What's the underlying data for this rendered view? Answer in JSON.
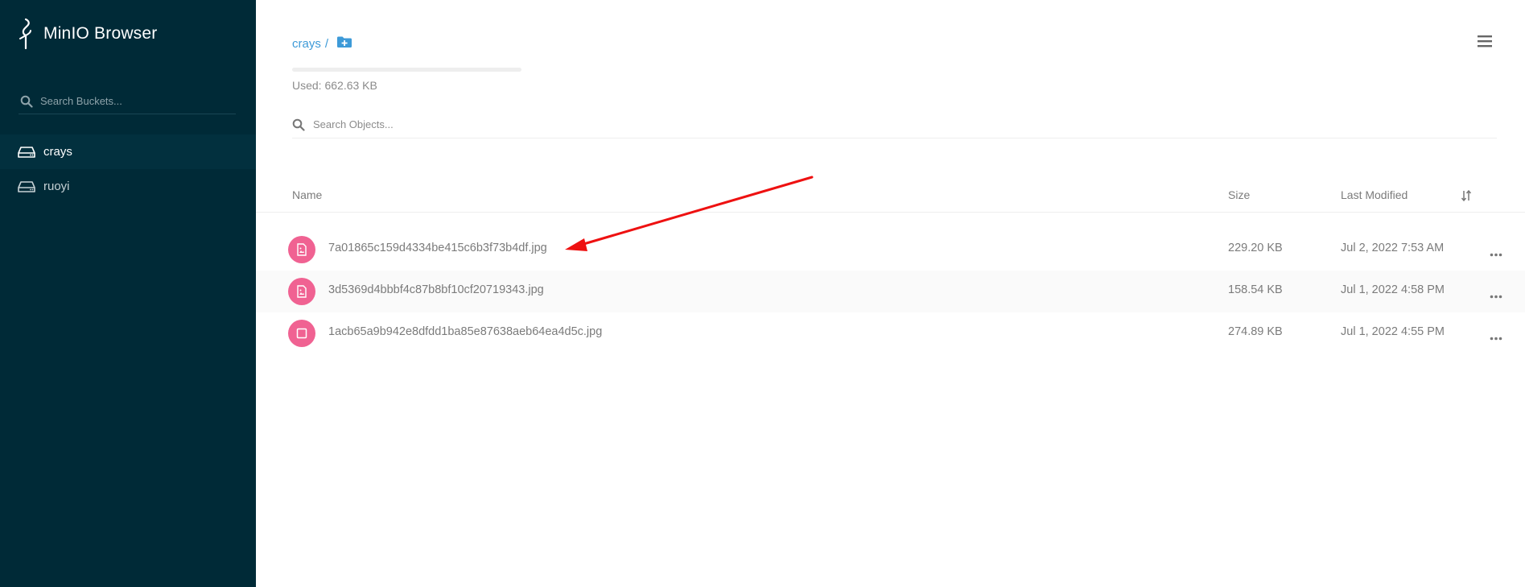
{
  "brand": {
    "name": "MinIO Browser"
  },
  "sidebar": {
    "search_placeholder": "Search Buckets...",
    "buckets": [
      {
        "label": "crays",
        "active": true
      },
      {
        "label": "ruoyi",
        "active": false
      }
    ]
  },
  "main": {
    "breadcrumb": {
      "bucket": "crays",
      "separator": "/"
    },
    "usage": {
      "text": "Used: 662.63 KB",
      "fraction": 0.0
    },
    "search_placeholder": "Search Objects...",
    "table": {
      "headers": {
        "name": "Name",
        "size": "Size",
        "modified": "Last Modified"
      },
      "rows": [
        {
          "name": "7a01865c159d4334be415c6b3f73b4df.jpg",
          "size": "229.20 KB",
          "modified": "Jul 2, 2022 7:53 AM",
          "icon": "image-file-icon"
        },
        {
          "name": "3d5369d4bbbf4c87b8bf10cf20719343.jpg",
          "size": "158.54 KB",
          "modified": "Jul 1, 2022 4:58 PM",
          "icon": "image-file-icon"
        },
        {
          "name": "1acb65a9b942e8dfdd1ba85e87638aeb64ea4d5c.jpg",
          "size": "274.89 KB",
          "modified": "Jul 1, 2022 4:55 PM",
          "icon": "generic-file-icon"
        }
      ]
    }
  },
  "colors": {
    "sidebar_bg": "#002a37",
    "link": "#3d9ad8",
    "file_icon_bg": "#f06292",
    "annotation_arrow": "#ee1111"
  }
}
